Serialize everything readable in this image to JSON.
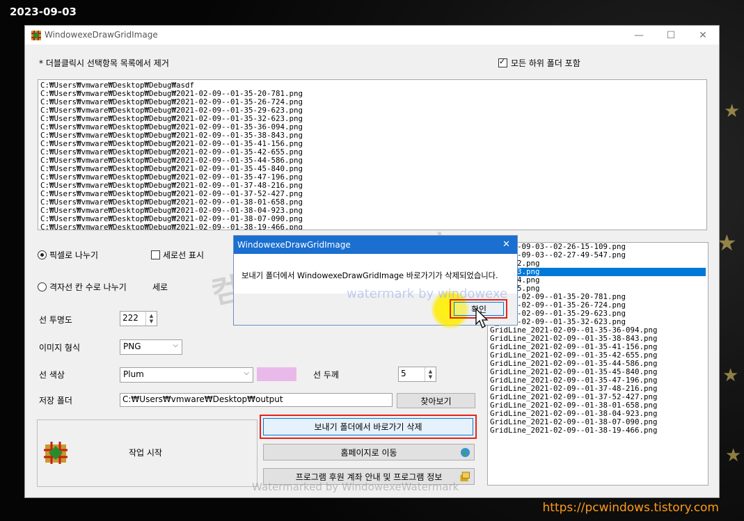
{
  "overlay": {
    "date_stamp": "2023-09-03",
    "site_url": "https://pcwindows.tistory.com",
    "watermark_kr": "컴퓨터 관련 정보",
    "watermark_en": "watermark by windowexe",
    "watermark_bottom": "Watermarked by WindowexeWatermark"
  },
  "window": {
    "title": "WindowexeDrawGridImage",
    "minimize": "—",
    "maximize": "☐",
    "close": "✕"
  },
  "top": {
    "hint": "* 더블클릭시 선택항목 목록에서 제거",
    "include_subfolders": "모든 하위 폴더 포함",
    "include_subfolders_checked": true
  },
  "source_list": [
    "C:₩Users₩vmware₩Desktop₩Debug₩asdf",
    "C:₩Users₩vmware₩Desktop₩Debug₩2021-02-09--01-35-20-781.png",
    "C:₩Users₩vmware₩Desktop₩Debug₩2021-02-09--01-35-26-724.png",
    "C:₩Users₩vmware₩Desktop₩Debug₩2021-02-09--01-35-29-623.png",
    "C:₩Users₩vmware₩Desktop₩Debug₩2021-02-09--01-35-32-623.png",
    "C:₩Users₩vmware₩Desktop₩Debug₩2021-02-09--01-35-36-094.png",
    "C:₩Users₩vmware₩Desktop₩Debug₩2021-02-09--01-35-38-843.png",
    "C:₩Users₩vmware₩Desktop₩Debug₩2021-02-09--01-35-41-156.png",
    "C:₩Users₩vmware₩Desktop₩Debug₩2021-02-09--01-35-42-655.png",
    "C:₩Users₩vmware₩Desktop₩Debug₩2021-02-09--01-35-44-586.png",
    "C:₩Users₩vmware₩Desktop₩Debug₩2021-02-09--01-35-45-840.png",
    "C:₩Users₩vmware₩Desktop₩Debug₩2021-02-09--01-35-47-196.png",
    "C:₩Users₩vmware₩Desktop₩Debug₩2021-02-09--01-37-48-216.png",
    "C:₩Users₩vmware₩Desktop₩Debug₩2021-02-09--01-37-52-427.png",
    "C:₩Users₩vmware₩Desktop₩Debug₩2021-02-09--01-38-01-658.png",
    "C:₩Users₩vmware₩Desktop₩Debug₩2021-02-09--01-38-04-923.png",
    "C:₩Users₩vmware₩Desktop₩Debug₩2021-02-09--01-38-07-090.png",
    "C:₩Users₩vmware₩Desktop₩Debug₩2021-02-09--01-38-19-466.png"
  ],
  "options": {
    "radio_pixel": "픽셀로 나누기",
    "radio_pixel_selected": true,
    "checkbox_vertical": "세로선 표시",
    "radio_grid": "격자선 칸 수로 나누기",
    "grid_vertical_label": "세로",
    "opacity_label": "선 투명도",
    "opacity_value": "222",
    "format_label": "이미지 형식",
    "format_value": "PNG",
    "color_label": "선 색상",
    "color_value": "Plum",
    "color_swatch": "#e9b9ea",
    "thickness_label": "선 두께",
    "thickness_value": "5",
    "save_label": "저장 폴더",
    "save_value": "C:₩Users₩vmware₩Desktop₩output",
    "browse_button": "찾아보기"
  },
  "actions": {
    "start": "작업 시작",
    "delete_shortcut": "보내기 폴더에서 바로가기 삭제",
    "homepage": "홈페이지로 이동",
    "program_info": "프로그램 후원 계좌 안내 및 프로그램 정보"
  },
  "result_list": [
    {
      "text": "e_2023-09-03--02-26-15-109.png",
      "selected": false
    },
    {
      "text": "e_2023-09-03--02-27-49-547.png",
      "selected": false
    },
    {
      "text": "e_aa_02.png",
      "selected": false
    },
    {
      "text": "e_aa_03.png",
      "selected": true
    },
    {
      "text": "e_aa_04.png",
      "selected": false
    },
    {
      "text": "e_aa_05.png",
      "selected": false
    },
    {
      "text": "e_2021-02-09--01-35-20-781.png",
      "selected": false
    },
    {
      "text": "e_2021-02-09--01-35-26-724.png",
      "selected": false
    },
    {
      "text": "e_2021-02-09--01-35-29-623.png",
      "selected": false
    },
    {
      "text": "e_2021-02-09--01-35-32-623.png",
      "selected": false
    },
    {
      "text": "GridLine_2021-02-09--01-35-36-094.png",
      "selected": false
    },
    {
      "text": "GridLine_2021-02-09--01-35-38-843.png",
      "selected": false
    },
    {
      "text": "GridLine_2021-02-09--01-35-41-156.png",
      "selected": false
    },
    {
      "text": "GridLine_2021-02-09--01-35-42-655.png",
      "selected": false
    },
    {
      "text": "GridLine_2021-02-09--01-35-44-586.png",
      "selected": false
    },
    {
      "text": "GridLine_2021-02-09--01-35-45-840.png",
      "selected": false
    },
    {
      "text": "GridLine_2021-02-09--01-35-47-196.png",
      "selected": false
    },
    {
      "text": "GridLine_2021-02-09--01-37-48-216.png",
      "selected": false
    },
    {
      "text": "GridLine_2021-02-09--01-37-52-427.png",
      "selected": false
    },
    {
      "text": "GridLine_2021-02-09--01-38-01-658.png",
      "selected": false
    },
    {
      "text": "GridLine_2021-02-09--01-38-04-923.png",
      "selected": false
    },
    {
      "text": "GridLine_2021-02-09--01-38-07-090.png",
      "selected": false
    },
    {
      "text": "GridLine_2021-02-09--01-38-19-466.png",
      "selected": false
    }
  ],
  "dialog": {
    "title": "WindowexeDrawGridImage",
    "close": "✕",
    "message": "보내기 폴더에서 WindowexeDrawGridImage 바로가기가 삭제되었습니다.",
    "ok_button": "확인"
  },
  "icons": {
    "app": "app-grid-icon",
    "globe": "globe-icon",
    "info": "info-icon",
    "cursor": "mouse-cursor-icon"
  }
}
